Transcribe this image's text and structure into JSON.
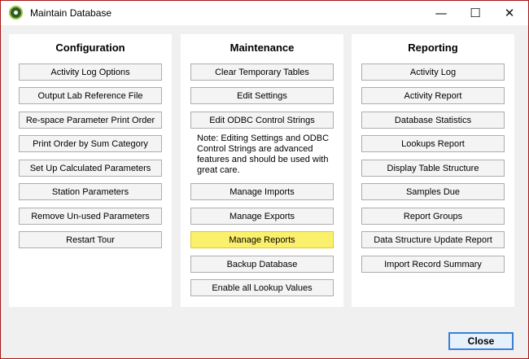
{
  "window": {
    "title": "Maintain Database",
    "minimize_glyph": "—",
    "maximize_glyph": "☐",
    "close_glyph": "✕"
  },
  "configuration": {
    "title": "Configuration",
    "buttons": [
      "Activity Log Options",
      "Output Lab Reference File",
      "Re-space Parameter Print Order",
      "Print Order by Sum Category",
      "Set Up Calculated Parameters",
      "Station Parameters",
      "Remove Un-used Parameters",
      "Restart Tour"
    ]
  },
  "maintenance": {
    "title": "Maintenance",
    "buttons_top": [
      "Clear Temporary Tables",
      "Edit Settings",
      "Edit ODBC Control Strings"
    ],
    "note": "Note: Editing Settings and ODBC Control Strings are advanced features and should be used with great care.",
    "buttons_bottom": [
      "Manage Imports",
      "Manage Exports",
      "Manage Reports",
      "Backup Database",
      "Enable all Lookup Values"
    ],
    "highlight_color": "#fbf06c"
  },
  "reporting": {
    "title": "Reporting",
    "buttons": [
      "Activity Log",
      "Activity Report",
      "Database Statistics",
      "Lookups Report",
      "Display Table Structure",
      "Samples Due",
      "Report Groups",
      "Data Structure Update Report",
      "Import Record Summary"
    ]
  },
  "footer": {
    "close_label": "Close"
  }
}
